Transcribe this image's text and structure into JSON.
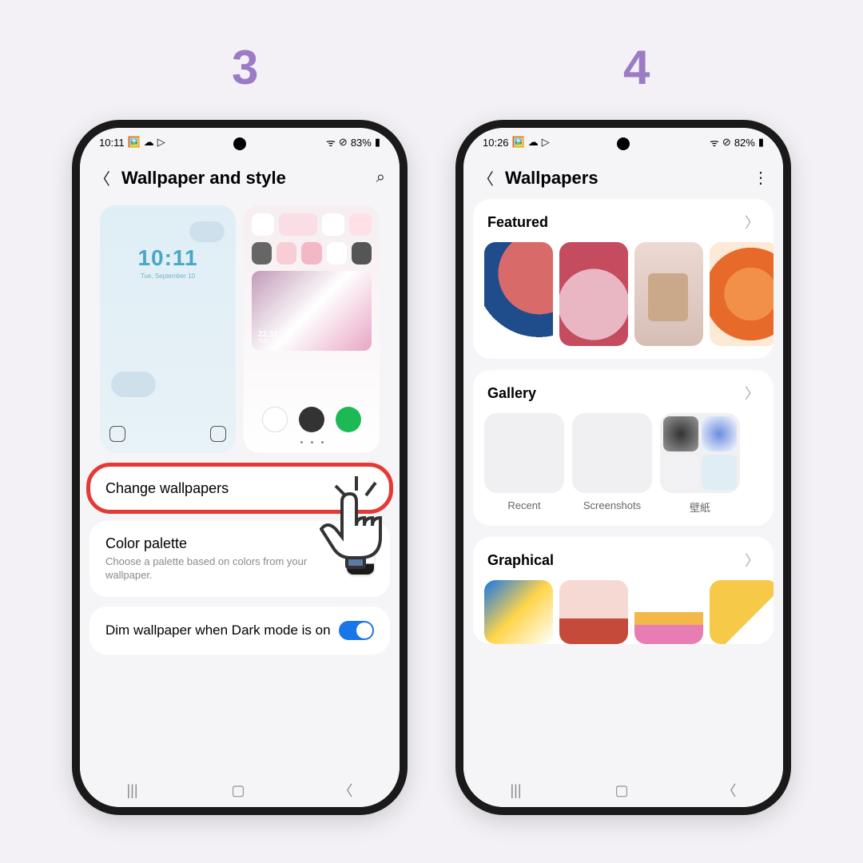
{
  "steps": {
    "s3": "3",
    "s4": "4"
  },
  "phone1": {
    "status": {
      "time": "10:11",
      "battery": "83%"
    },
    "title": "Wallpaper and style",
    "lock": {
      "time": "10:11",
      "date": "Tue, September 10"
    },
    "home": {
      "time": "22:11",
      "date": "TUE, Sept 10"
    },
    "change": "Change wallpapers",
    "palette": {
      "title": "Color palette",
      "sub": "Choose a palette based on colors from your wallpaper."
    },
    "dim": "Dim wallpaper when Dark mode is on"
  },
  "phone2": {
    "status": {
      "time": "10:26",
      "battery": "82%"
    },
    "title": "Wallpapers",
    "featured": "Featured",
    "gallery": {
      "title": "Gallery",
      "items": [
        "Recent",
        "Screenshots",
        "壁紙"
      ]
    },
    "graphical": "Graphical"
  }
}
